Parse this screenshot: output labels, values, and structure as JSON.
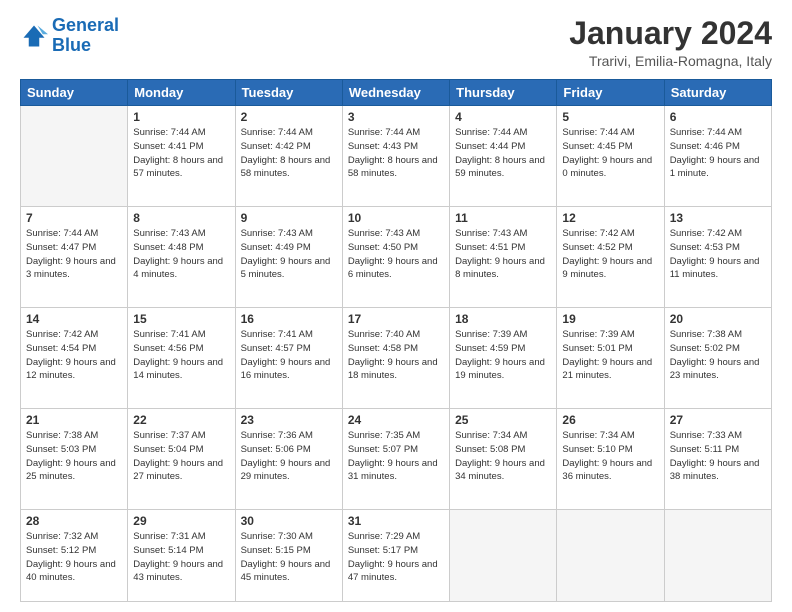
{
  "header": {
    "logo_line1": "General",
    "logo_line2": "Blue",
    "main_title": "January 2024",
    "subtitle": "Trarivi, Emilia-Romagna, Italy"
  },
  "days_of_week": [
    "Sunday",
    "Monday",
    "Tuesday",
    "Wednesday",
    "Thursday",
    "Friday",
    "Saturday"
  ],
  "weeks": [
    [
      {
        "num": "",
        "sunrise": "",
        "sunset": "",
        "daylight": "",
        "empty": true
      },
      {
        "num": "1",
        "sunrise": "Sunrise: 7:44 AM",
        "sunset": "Sunset: 4:41 PM",
        "daylight": "Daylight: 8 hours and 57 minutes."
      },
      {
        "num": "2",
        "sunrise": "Sunrise: 7:44 AM",
        "sunset": "Sunset: 4:42 PM",
        "daylight": "Daylight: 8 hours and 58 minutes."
      },
      {
        "num": "3",
        "sunrise": "Sunrise: 7:44 AM",
        "sunset": "Sunset: 4:43 PM",
        "daylight": "Daylight: 8 hours and 58 minutes."
      },
      {
        "num": "4",
        "sunrise": "Sunrise: 7:44 AM",
        "sunset": "Sunset: 4:44 PM",
        "daylight": "Daylight: 8 hours and 59 minutes."
      },
      {
        "num": "5",
        "sunrise": "Sunrise: 7:44 AM",
        "sunset": "Sunset: 4:45 PM",
        "daylight": "Daylight: 9 hours and 0 minutes."
      },
      {
        "num": "6",
        "sunrise": "Sunrise: 7:44 AM",
        "sunset": "Sunset: 4:46 PM",
        "daylight": "Daylight: 9 hours and 1 minute."
      }
    ],
    [
      {
        "num": "7",
        "sunrise": "Sunrise: 7:44 AM",
        "sunset": "Sunset: 4:47 PM",
        "daylight": "Daylight: 9 hours and 3 minutes."
      },
      {
        "num": "8",
        "sunrise": "Sunrise: 7:43 AM",
        "sunset": "Sunset: 4:48 PM",
        "daylight": "Daylight: 9 hours and 4 minutes."
      },
      {
        "num": "9",
        "sunrise": "Sunrise: 7:43 AM",
        "sunset": "Sunset: 4:49 PM",
        "daylight": "Daylight: 9 hours and 5 minutes."
      },
      {
        "num": "10",
        "sunrise": "Sunrise: 7:43 AM",
        "sunset": "Sunset: 4:50 PM",
        "daylight": "Daylight: 9 hours and 6 minutes."
      },
      {
        "num": "11",
        "sunrise": "Sunrise: 7:43 AM",
        "sunset": "Sunset: 4:51 PM",
        "daylight": "Daylight: 9 hours and 8 minutes."
      },
      {
        "num": "12",
        "sunrise": "Sunrise: 7:42 AM",
        "sunset": "Sunset: 4:52 PM",
        "daylight": "Daylight: 9 hours and 9 minutes."
      },
      {
        "num": "13",
        "sunrise": "Sunrise: 7:42 AM",
        "sunset": "Sunset: 4:53 PM",
        "daylight": "Daylight: 9 hours and 11 minutes."
      }
    ],
    [
      {
        "num": "14",
        "sunrise": "Sunrise: 7:42 AM",
        "sunset": "Sunset: 4:54 PM",
        "daylight": "Daylight: 9 hours and 12 minutes."
      },
      {
        "num": "15",
        "sunrise": "Sunrise: 7:41 AM",
        "sunset": "Sunset: 4:56 PM",
        "daylight": "Daylight: 9 hours and 14 minutes."
      },
      {
        "num": "16",
        "sunrise": "Sunrise: 7:41 AM",
        "sunset": "Sunset: 4:57 PM",
        "daylight": "Daylight: 9 hours and 16 minutes."
      },
      {
        "num": "17",
        "sunrise": "Sunrise: 7:40 AM",
        "sunset": "Sunset: 4:58 PM",
        "daylight": "Daylight: 9 hours and 18 minutes."
      },
      {
        "num": "18",
        "sunrise": "Sunrise: 7:39 AM",
        "sunset": "Sunset: 4:59 PM",
        "daylight": "Daylight: 9 hours and 19 minutes."
      },
      {
        "num": "19",
        "sunrise": "Sunrise: 7:39 AM",
        "sunset": "Sunset: 5:01 PM",
        "daylight": "Daylight: 9 hours and 21 minutes."
      },
      {
        "num": "20",
        "sunrise": "Sunrise: 7:38 AM",
        "sunset": "Sunset: 5:02 PM",
        "daylight": "Daylight: 9 hours and 23 minutes."
      }
    ],
    [
      {
        "num": "21",
        "sunrise": "Sunrise: 7:38 AM",
        "sunset": "Sunset: 5:03 PM",
        "daylight": "Daylight: 9 hours and 25 minutes."
      },
      {
        "num": "22",
        "sunrise": "Sunrise: 7:37 AM",
        "sunset": "Sunset: 5:04 PM",
        "daylight": "Daylight: 9 hours and 27 minutes."
      },
      {
        "num": "23",
        "sunrise": "Sunrise: 7:36 AM",
        "sunset": "Sunset: 5:06 PM",
        "daylight": "Daylight: 9 hours and 29 minutes."
      },
      {
        "num": "24",
        "sunrise": "Sunrise: 7:35 AM",
        "sunset": "Sunset: 5:07 PM",
        "daylight": "Daylight: 9 hours and 31 minutes."
      },
      {
        "num": "25",
        "sunrise": "Sunrise: 7:34 AM",
        "sunset": "Sunset: 5:08 PM",
        "daylight": "Daylight: 9 hours and 34 minutes."
      },
      {
        "num": "26",
        "sunrise": "Sunrise: 7:34 AM",
        "sunset": "Sunset: 5:10 PM",
        "daylight": "Daylight: 9 hours and 36 minutes."
      },
      {
        "num": "27",
        "sunrise": "Sunrise: 7:33 AM",
        "sunset": "Sunset: 5:11 PM",
        "daylight": "Daylight: 9 hours and 38 minutes."
      }
    ],
    [
      {
        "num": "28",
        "sunrise": "Sunrise: 7:32 AM",
        "sunset": "Sunset: 5:12 PM",
        "daylight": "Daylight: 9 hours and 40 minutes."
      },
      {
        "num": "29",
        "sunrise": "Sunrise: 7:31 AM",
        "sunset": "Sunset: 5:14 PM",
        "daylight": "Daylight: 9 hours and 43 minutes."
      },
      {
        "num": "30",
        "sunrise": "Sunrise: 7:30 AM",
        "sunset": "Sunset: 5:15 PM",
        "daylight": "Daylight: 9 hours and 45 minutes."
      },
      {
        "num": "31",
        "sunrise": "Sunrise: 7:29 AM",
        "sunset": "Sunset: 5:17 PM",
        "daylight": "Daylight: 9 hours and 47 minutes."
      },
      {
        "num": "",
        "sunrise": "",
        "sunset": "",
        "daylight": "",
        "empty": true
      },
      {
        "num": "",
        "sunrise": "",
        "sunset": "",
        "daylight": "",
        "empty": true
      },
      {
        "num": "",
        "sunrise": "",
        "sunset": "",
        "daylight": "",
        "empty": true
      }
    ]
  ]
}
